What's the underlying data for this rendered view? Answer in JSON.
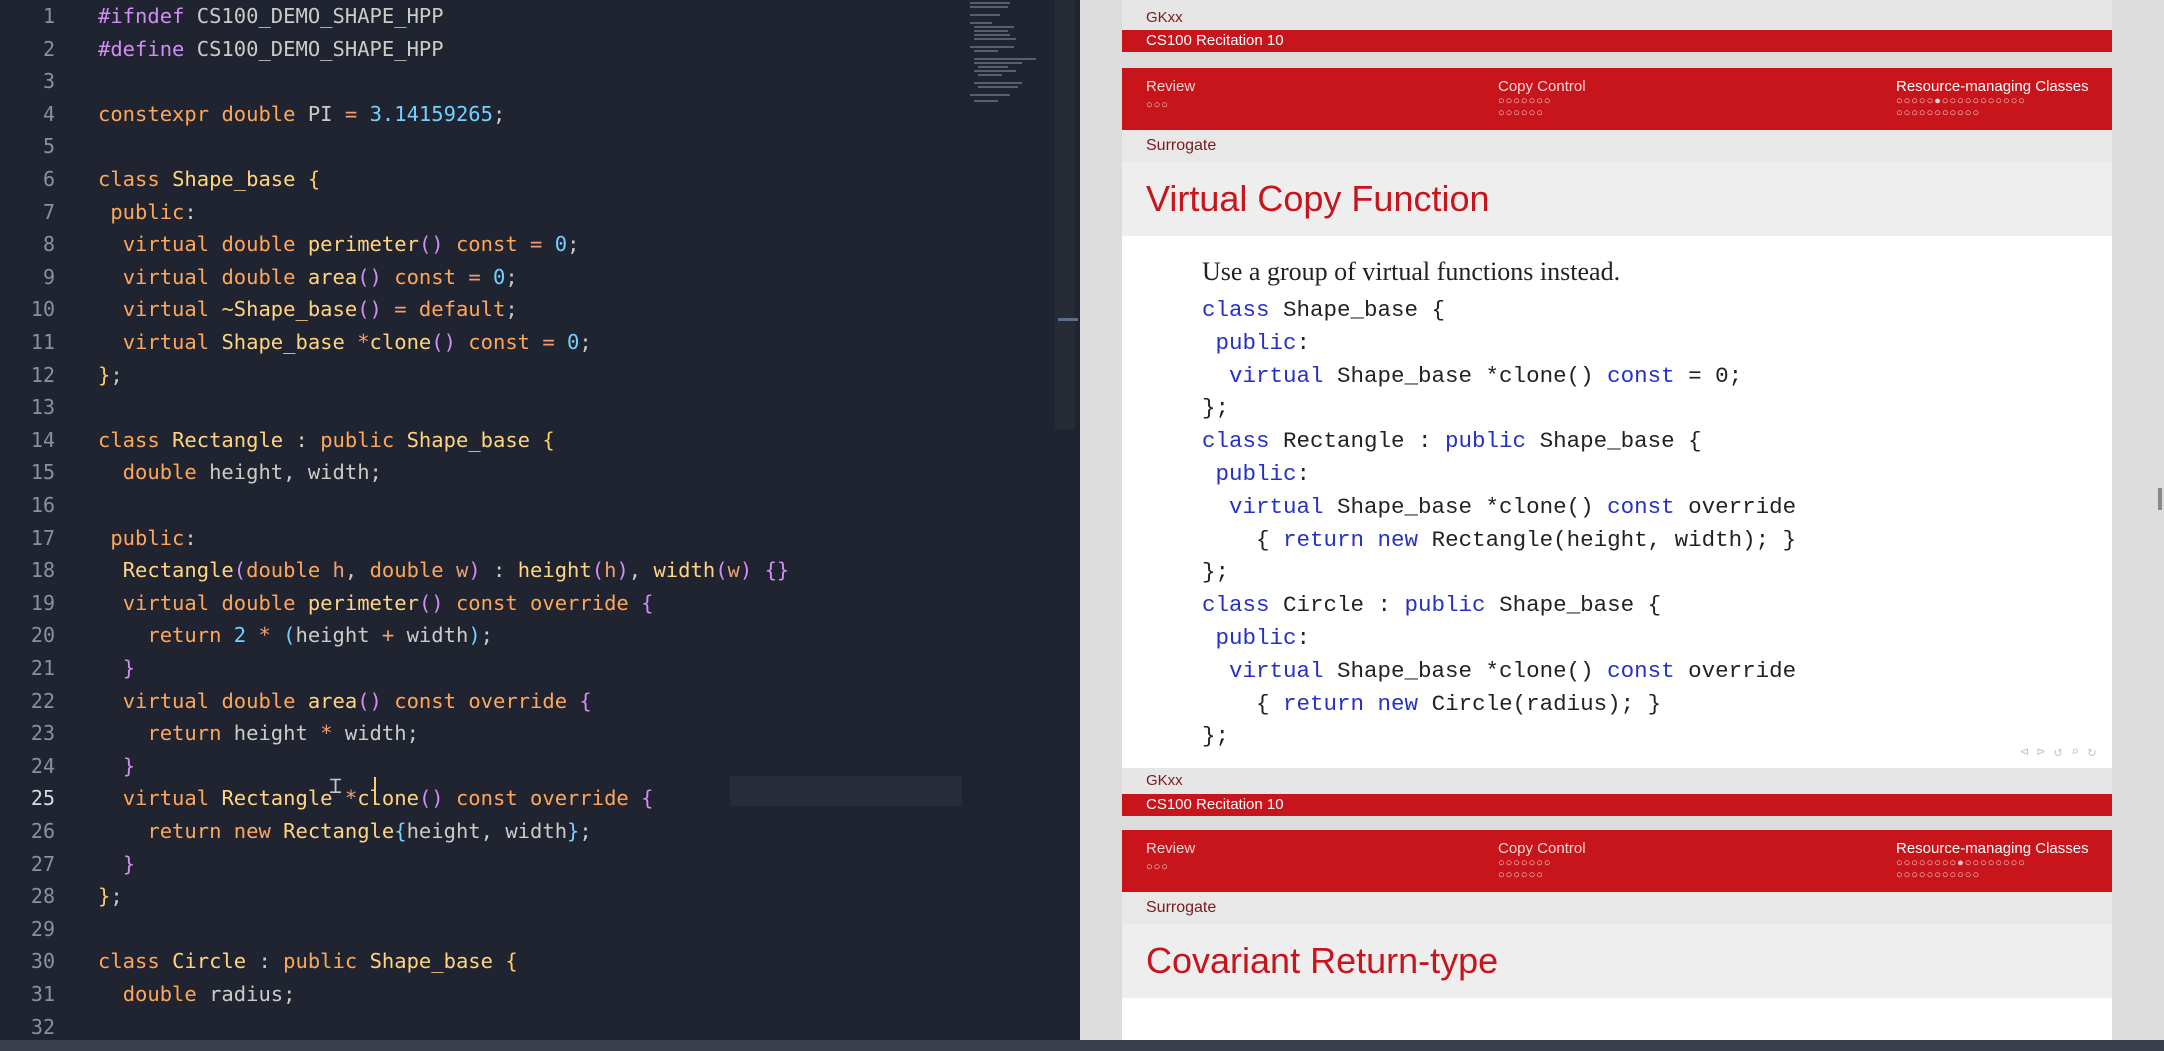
{
  "editor": {
    "active_line": 25,
    "lines": [
      {
        "n": "1",
        "html": "<span class=\"p\">#ifndef</span> <span class=\"pl\">CS100_DEMO_SHAPE_HPP</span>"
      },
      {
        "n": "2",
        "html": "<span class=\"p\">#define</span> <span class=\"pl\">CS100_DEMO_SHAPE_HPP</span>"
      },
      {
        "n": "3",
        "html": ""
      },
      {
        "n": "4",
        "html": "<span class=\"k\">constexpr</span> <span class=\"k\">double</span> <span class=\"pl\">PI</span> <span class=\"op\">=</span> <span class=\"t\">3.14159265</span><span class=\"pl\">;</span>"
      },
      {
        "n": "5",
        "html": ""
      },
      {
        "n": "6",
        "html": "<span class=\"k\">class</span> <span class=\"ty\">Shape_base</span> <span class=\"n\">{</span>"
      },
      {
        "n": "7",
        "html": " <span class=\"k\">public</span><span class=\"pl\">:</span>"
      },
      {
        "n": "8",
        "html": "  <span class=\"k\">virtual</span> <span class=\"k\">double</span> <span class=\"f\">perimeter</span><span class=\"p\">()</span> <span class=\"k\">const</span> <span class=\"op\">=</span> <span class=\"t\">0</span><span class=\"pl\">;</span>"
      },
      {
        "n": "9",
        "html": "  <span class=\"k\">virtual</span> <span class=\"k\">double</span> <span class=\"f\">area</span><span class=\"p\">()</span> <span class=\"k\">const</span> <span class=\"op\">=</span> <span class=\"t\">0</span><span class=\"pl\">;</span>"
      },
      {
        "n": "10",
        "html": "  <span class=\"k\">virtual</span> <span class=\"f\">~Shape_base</span><span class=\"p\">()</span> <span class=\"op\">=</span> <span class=\"k\">default</span><span class=\"pl\">;</span>"
      },
      {
        "n": "11",
        "html": "  <span class=\"k\">virtual</span> <span class=\"ty\">Shape_base</span> <span class=\"op\">*</span><span class=\"f\">clone</span><span class=\"p\">()</span> <span class=\"k\">const</span> <span class=\"op\">=</span> <span class=\"t\">0</span><span class=\"pl\">;</span>"
      },
      {
        "n": "12",
        "html": "<span class=\"n\">}</span><span class=\"pl\">;</span>"
      },
      {
        "n": "13",
        "html": ""
      },
      {
        "n": "14",
        "html": "<span class=\"k\">class</span> <span class=\"ty\">Rectangle</span> <span class=\"pl\">:</span> <span class=\"k\">public</span> <span class=\"ty\">Shape_base</span> <span class=\"n\">{</span>"
      },
      {
        "n": "15",
        "html": "  <span class=\"k\">double</span> <span class=\"pl\">height, width;</span>"
      },
      {
        "n": "16",
        "html": ""
      },
      {
        "n": "17",
        "html": " <span class=\"k\">public</span><span class=\"pl\">:</span>"
      },
      {
        "n": "18",
        "html": "  <span class=\"f\">Rectangle</span><span class=\"p\">(</span><span class=\"k\">double</span> <span class=\"pp\">h</span><span class=\"pl\">,</span> <span class=\"k\">double</span> <span class=\"pp\">w</span><span class=\"p\">)</span> <span class=\"pl\">:</span> <span class=\"f\">height</span><span class=\"p\">(</span><span class=\"pp\">h</span><span class=\"p\">)</span><span class=\"pl\">,</span> <span class=\"f\">width</span><span class=\"p\">(</span><span class=\"pp\">w</span><span class=\"p\">)</span> <span class=\"p\">{}</span>"
      },
      {
        "n": "19",
        "html": "  <span class=\"k\">virtual</span> <span class=\"k\">double</span> <span class=\"f\">perimeter</span><span class=\"p\">()</span> <span class=\"k\">const</span> <span class=\"k\">override</span> <span class=\"p\">{</span>"
      },
      {
        "n": "20",
        "html": "    <span class=\"k\">return</span> <span class=\"t\">2</span> <span class=\"op\">*</span> <span class=\"t\">(</span><span class=\"pl\">height</span> <span class=\"op\">+</span> <span class=\"pl\">width</span><span class=\"t\">)</span><span class=\"pl\">;</span>"
      },
      {
        "n": "21",
        "html": "  <span class=\"p\">}</span>"
      },
      {
        "n": "22",
        "html": "  <span class=\"k\">virtual</span> <span class=\"k\">double</span> <span class=\"f\">area</span><span class=\"p\">()</span> <span class=\"k\">const</span> <span class=\"k\">override</span> <span class=\"p\">{</span>"
      },
      {
        "n": "23",
        "html": "    <span class=\"k\">return</span> <span class=\"pl\">height</span> <span class=\"op\">*</span> <span class=\"pl\">width;</span>"
      },
      {
        "n": "24",
        "html": "  <span class=\"p\">}</span>"
      },
      {
        "n": "25",
        "html": "  <span class=\"k\">virtual</span> <span class=\"ty\">Rectangle</span> <span class=\"op\">*</span><span class=\"f\">clone</span><span class=\"p\">()</span> <span class=\"k\">const</span> <span class=\"k\">override</span> <span class=\"p\">{</span>"
      },
      {
        "n": "26",
        "html": "    <span class=\"k\">return</span> <span class=\"k\">new</span> <span class=\"ty\">Rectangle</span><span class=\"t\">{</span><span class=\"pl\">height, width</span><span class=\"t\">}</span><span class=\"pl\">;</span>"
      },
      {
        "n": "27",
        "html": "  <span class=\"p\">}</span>"
      },
      {
        "n": "28",
        "html": "<span class=\"n\">}</span><span class=\"pl\">;</span>"
      },
      {
        "n": "29",
        "html": ""
      },
      {
        "n": "30",
        "html": "<span class=\"k\">class</span> <span class=\"ty\">Circle</span> <span class=\"pl\">:</span> <span class=\"k\">public</span> <span class=\"ty\">Shape_base</span> <span class=\"n\">{</span>"
      },
      {
        "n": "31",
        "html": "  <span class=\"k\">double</span> <span class=\"pl\">radius;</span>"
      },
      {
        "n": "32",
        "html": ""
      }
    ]
  },
  "slides": {
    "author": "GKxx",
    "course": "CS100 Recitation 10",
    "nav": {
      "review": "Review",
      "review_dots": "○○○",
      "copy_control": "Copy Control",
      "copy_dots_1": "○○○○○○○",
      "copy_dots_2": "○○○○○○",
      "resource": "Resource-managing Classes",
      "res_dots_1_a": "○○○○○●○○○○○○○○○○○",
      "res_dots_1_b": "○○○○○○○○○○○",
      "res_dots_2_a": "○○○○○○○○●○○○○○○○○",
      "res_dots_2_b": "○○○○○○○○○○○"
    },
    "subsection": "Surrogate",
    "slide1": {
      "title": "Virtual Copy Function",
      "lead": "Use a group of virtual functions instead.",
      "code": [
        "<span class=\"kw\">class</span> Shape_base {",
        " <span class=\"kw\">public</span>:",
        "  <span class=\"kw\">virtual</span> Shape_base *clone() <span class=\"kw\">const</span> = 0;",
        "};",
        "<span class=\"kw\">class</span> Rectangle : <span class=\"kw\">public</span> Shape_base {",
        " <span class=\"kw\">public</span>:",
        "  <span class=\"kw\">virtual</span> Shape_base *clone() <span class=\"kw\">const</span> override",
        "    { <span class=\"kw\">return</span> <span class=\"kw\">new</span> Rectangle(height, width); }",
        "};",
        "<span class=\"kw\">class</span> Circle : <span class=\"kw\">public</span> Shape_base {",
        " <span class=\"kw\">public</span>:",
        "  <span class=\"kw\">virtual</span> Shape_base *clone() <span class=\"kw\">const</span> override",
        "    { <span class=\"kw\">return</span> <span class=\"kw\">new</span> Circle(radius); }",
        "};"
      ]
    },
    "slide2": {
      "title": "Covariant Return-type"
    },
    "nav_symbols": "⊲ ⊳ ↺ ⌕ ↻"
  },
  "colors": {
    "editor_bg": "#1f2430",
    "beamer_red": "#c8151b",
    "keyword": "#ffa759",
    "type": "#ffd580",
    "number": "#73d0ff"
  }
}
